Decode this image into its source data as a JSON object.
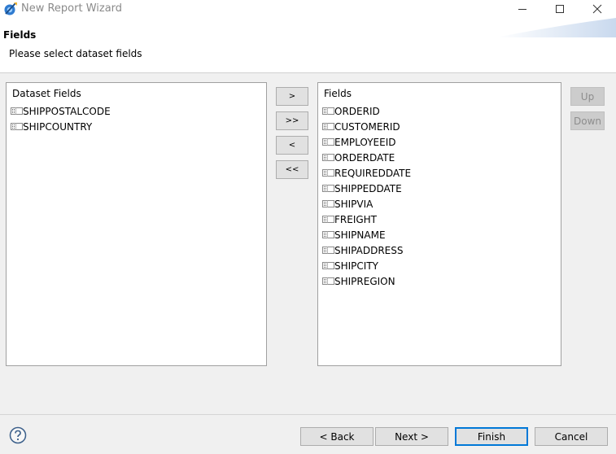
{
  "window": {
    "title": "New Report Wizard"
  },
  "header": {
    "title": "Fields",
    "subtitle": "Please select dataset fields"
  },
  "dataset_fields": {
    "caption": "Dataset Fields",
    "items": [
      "SHIPPOSTALCODE",
      "SHIPCOUNTRY"
    ]
  },
  "selected_fields": {
    "caption": "Fields",
    "items": [
      "ORDERID",
      "CUSTOMERID",
      "EMPLOYEEID",
      "ORDERDATE",
      "REQUIREDDATE",
      "SHIPPEDDATE",
      "SHIPVIA",
      "FREIGHT",
      "SHIPNAME",
      "SHIPADDRESS",
      "SHIPCITY",
      "SHIPREGION"
    ]
  },
  "transfer": {
    "add": ">",
    "add_all": ">>",
    "remove": "<",
    "remove_all": "<<"
  },
  "order": {
    "up": "Up",
    "down": "Down"
  },
  "footer": {
    "back": "< Back",
    "next": "Next >",
    "finish": "Finish",
    "cancel": "Cancel"
  },
  "icons": {
    "app": "wizard-app-icon",
    "minimize": "minimize-icon",
    "maximize": "maximize-icon",
    "close": "close-icon",
    "field": "field-icon",
    "help": "help-icon"
  },
  "colors": {
    "accent": "#0078d7",
    "header_bg": "#ffffff",
    "dialog_bg": "#f0f0f0"
  }
}
